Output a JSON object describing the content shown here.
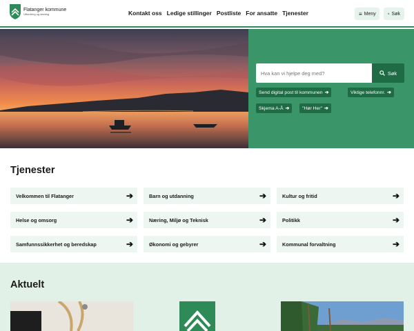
{
  "header": {
    "logo": {
      "name": "Flatanger kommune",
      "tagline": "Utfordring og løsning"
    },
    "nav": [
      "Kontakt oss",
      "Ledige stillinger",
      "Postliste",
      "For ansatte",
      "Tjenester"
    ],
    "menu_label": "Meny",
    "search_label": "Søk"
  },
  "hero": {
    "search_placeholder": "Hva kan vi hjelpe deg med?",
    "search_button": "Søk",
    "quick_links": [
      "Send digital post til kommunen",
      "Viktige telefonnr.",
      "Skjema A-Å",
      "\"Hør Her\""
    ]
  },
  "services": {
    "title": "Tjenester",
    "items": [
      "Velkommen til Flatanger",
      "Barn og utdanning",
      "Kultur og fritid",
      "Helse og omsorg",
      "Næring, Miljø og Teknisk",
      "Politikk",
      "Samfunnssikkerhet og beredskap",
      "Økonomi og gebyrer",
      "Kommunal forvaltning"
    ]
  },
  "news": {
    "title": "Aktuelt"
  },
  "colors": {
    "brand_green": "#3a9568",
    "dark_green": "#1f6b45",
    "light_green": "#e1f1e8",
    "card_bg": "#eef6f1"
  }
}
